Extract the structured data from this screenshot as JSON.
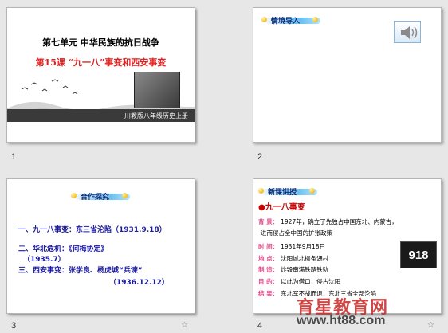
{
  "slides": [
    {
      "number": "1",
      "title_line1": "第七单元  中华民族的抗日战争",
      "title_line2": "第15课  “九一八”事变和西安事变",
      "band_text": "川教版八年级历史上册"
    },
    {
      "number": "2",
      "banner_label": "情境导入",
      "icon": "speaker-icon"
    },
    {
      "number": "3",
      "banner_label": "合作探究",
      "items": [
        "一、九一八事变：东三省沦陷（1931.9.18）",
        "二、华北危机：《何梅协定》",
        "（1935.7）",
        "三、西安事变：张学良、杨虎城“兵谏”",
        "（1936.12.12）"
      ]
    },
    {
      "number": "4",
      "banner_label": "新课讲授",
      "heading": "●九一八事变",
      "rows": [
        {
          "key": "背 景：",
          "value": "1927年，确立了先独占中国东北、内蒙古，"
        },
        {
          "key": "",
          "value": "进而侵占全中国的扩张政策"
        },
        {
          "key": "时 间：",
          "value": "1931年9月18日"
        },
        {
          "key": "地 点：",
          "value": "沈阳城北柳条湖村"
        },
        {
          "key": "制 造：",
          "value": "炸毁南满铁路铁轨"
        },
        {
          "key": "目 的：",
          "value": "以此为借口，侵占沈阳"
        },
        {
          "key": "结 果：",
          "value": "东北军不战而退，东北三省全部沦陷"
        }
      ],
      "badge": "918"
    }
  ],
  "watermark": {
    "line1": "育星教育网",
    "line2": "www.ht88.com"
  },
  "colors": {
    "background": "#e7e7e7",
    "title_red": "#e02020",
    "item_blue": "#1a1aa0",
    "key_pink": "#e64a8b"
  }
}
